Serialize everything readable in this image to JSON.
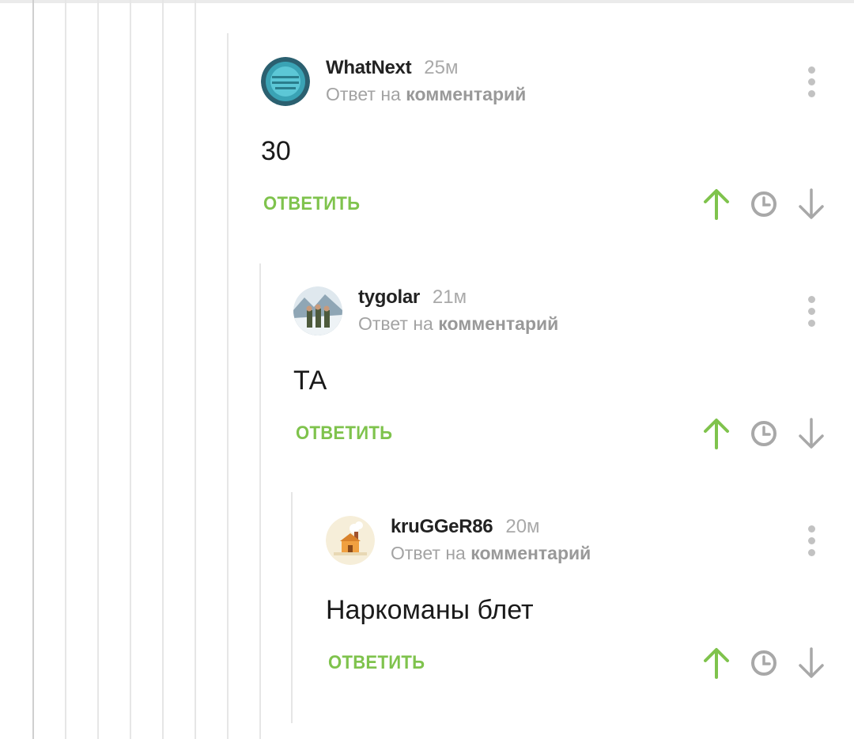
{
  "colors": {
    "accent": "#7fc34d",
    "muted": "#a3a3a3",
    "line": "#e6e6e6"
  },
  "comments": [
    {
      "author": "WhatNext",
      "time": "25м",
      "reply_prefix": "Ответ на",
      "reply_link": "комментарий",
      "text": "30",
      "reply_label": "ОТВЕТИТЬ",
      "avatar": "teal-coin-avatar"
    },
    {
      "author": "tygolar",
      "time": "21м",
      "reply_prefix": "Ответ на",
      "reply_link": "комментарий",
      "text": "ТА",
      "reply_label": "ОТВЕТИТЬ",
      "avatar": "soldiers-snow-avatar"
    },
    {
      "author": "kruGGeR86",
      "time": "20м",
      "reply_prefix": "Ответ на",
      "reply_link": "комментарий",
      "text": "Наркоманы блет",
      "reply_label": "ОТВЕТИТЬ",
      "avatar": "house-cartoon-avatar"
    }
  ],
  "icons": {
    "upvote": "arrow-up-icon",
    "history": "clock-icon",
    "downvote": "arrow-down-icon",
    "more": "more-vertical-icon"
  }
}
